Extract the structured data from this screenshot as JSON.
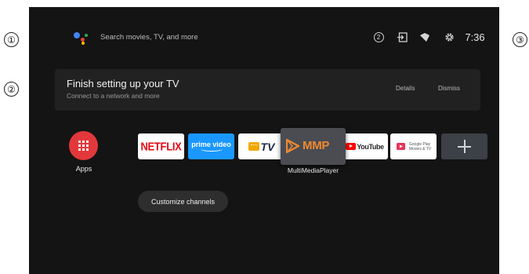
{
  "callouts": [
    "①",
    "②",
    "③"
  ],
  "search": {
    "placeholder": "Search movies, TV, and more"
  },
  "status_bar": {
    "notification_count": "2",
    "icons": [
      "assistant-icon",
      "input-icon",
      "wifi-icon",
      "settings-icon"
    ],
    "clock": "7:36"
  },
  "setup_card": {
    "title": "Finish setting up your TV",
    "subtitle": "Connect to a network and more",
    "details_label": "Details",
    "dismiss_label": "Dismiss"
  },
  "apps": {
    "label": "Apps",
    "color": "#e2383b"
  },
  "favorites": {
    "tiles": [
      {
        "name": "NETFLIX",
        "color": "#e50914"
      },
      {
        "name": "prime video",
        "color": "#1a98ff"
      },
      {
        "name": "TV",
        "color": "#f2a900"
      },
      {
        "name": "MMP",
        "color": "#ef8a30"
      },
      {
        "name": "YouTube",
        "color": "#ff0000"
      },
      {
        "name": "Google Play Movies & TV",
        "lines": [
          "Google Play",
          "Movies & TV"
        ]
      },
      {
        "name": "add-app",
        "icon": "plus-icon"
      }
    ],
    "focused_caption": "MultiMediaPlayer"
  },
  "customize_channels_label": "Customize channels",
  "colors": {
    "background": "#141414",
    "card": "#212121",
    "focused_tile": "#4a4c52"
  }
}
